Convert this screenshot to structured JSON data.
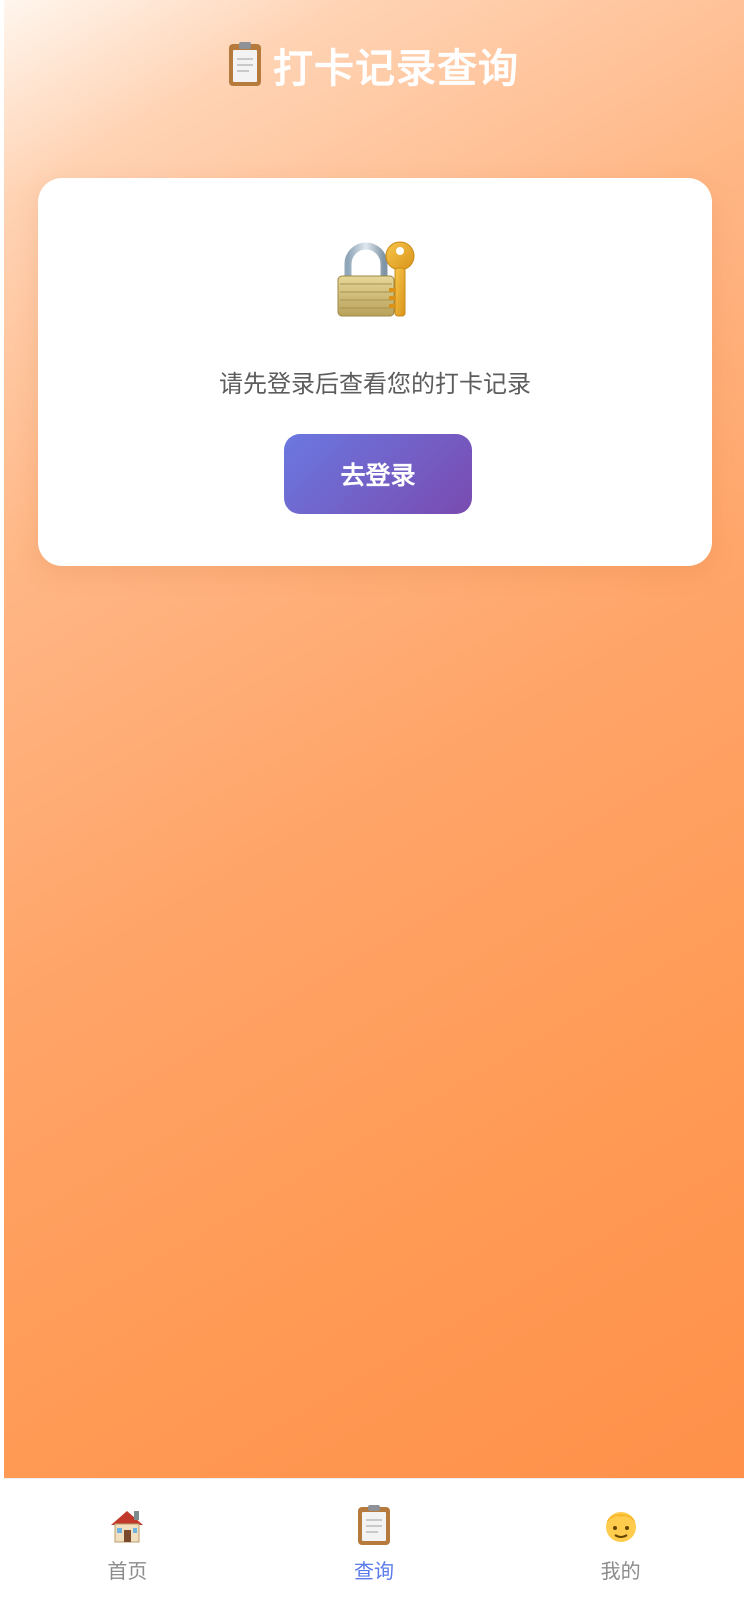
{
  "header": {
    "title": "打卡记录查询",
    "icon": "clipboard-icon"
  },
  "login_prompt": {
    "icon": "lock-with-key-icon",
    "message": "请先登录后查看您的打卡记录",
    "button_label": "去登录"
  },
  "tab_bar": {
    "active_index": 1,
    "tabs": [
      {
        "label": "首页",
        "icon": "house-icon"
      },
      {
        "label": "查询",
        "icon": "clipboard-icon"
      },
      {
        "label": "我的",
        "icon": "user-icon"
      }
    ]
  },
  "colors": {
    "accent": "#5b7be8",
    "background_top": "#ffd3b4",
    "background_bottom": "#ff8e46",
    "button_start": "#6a78e0",
    "button_end": "#7a4bb0"
  }
}
